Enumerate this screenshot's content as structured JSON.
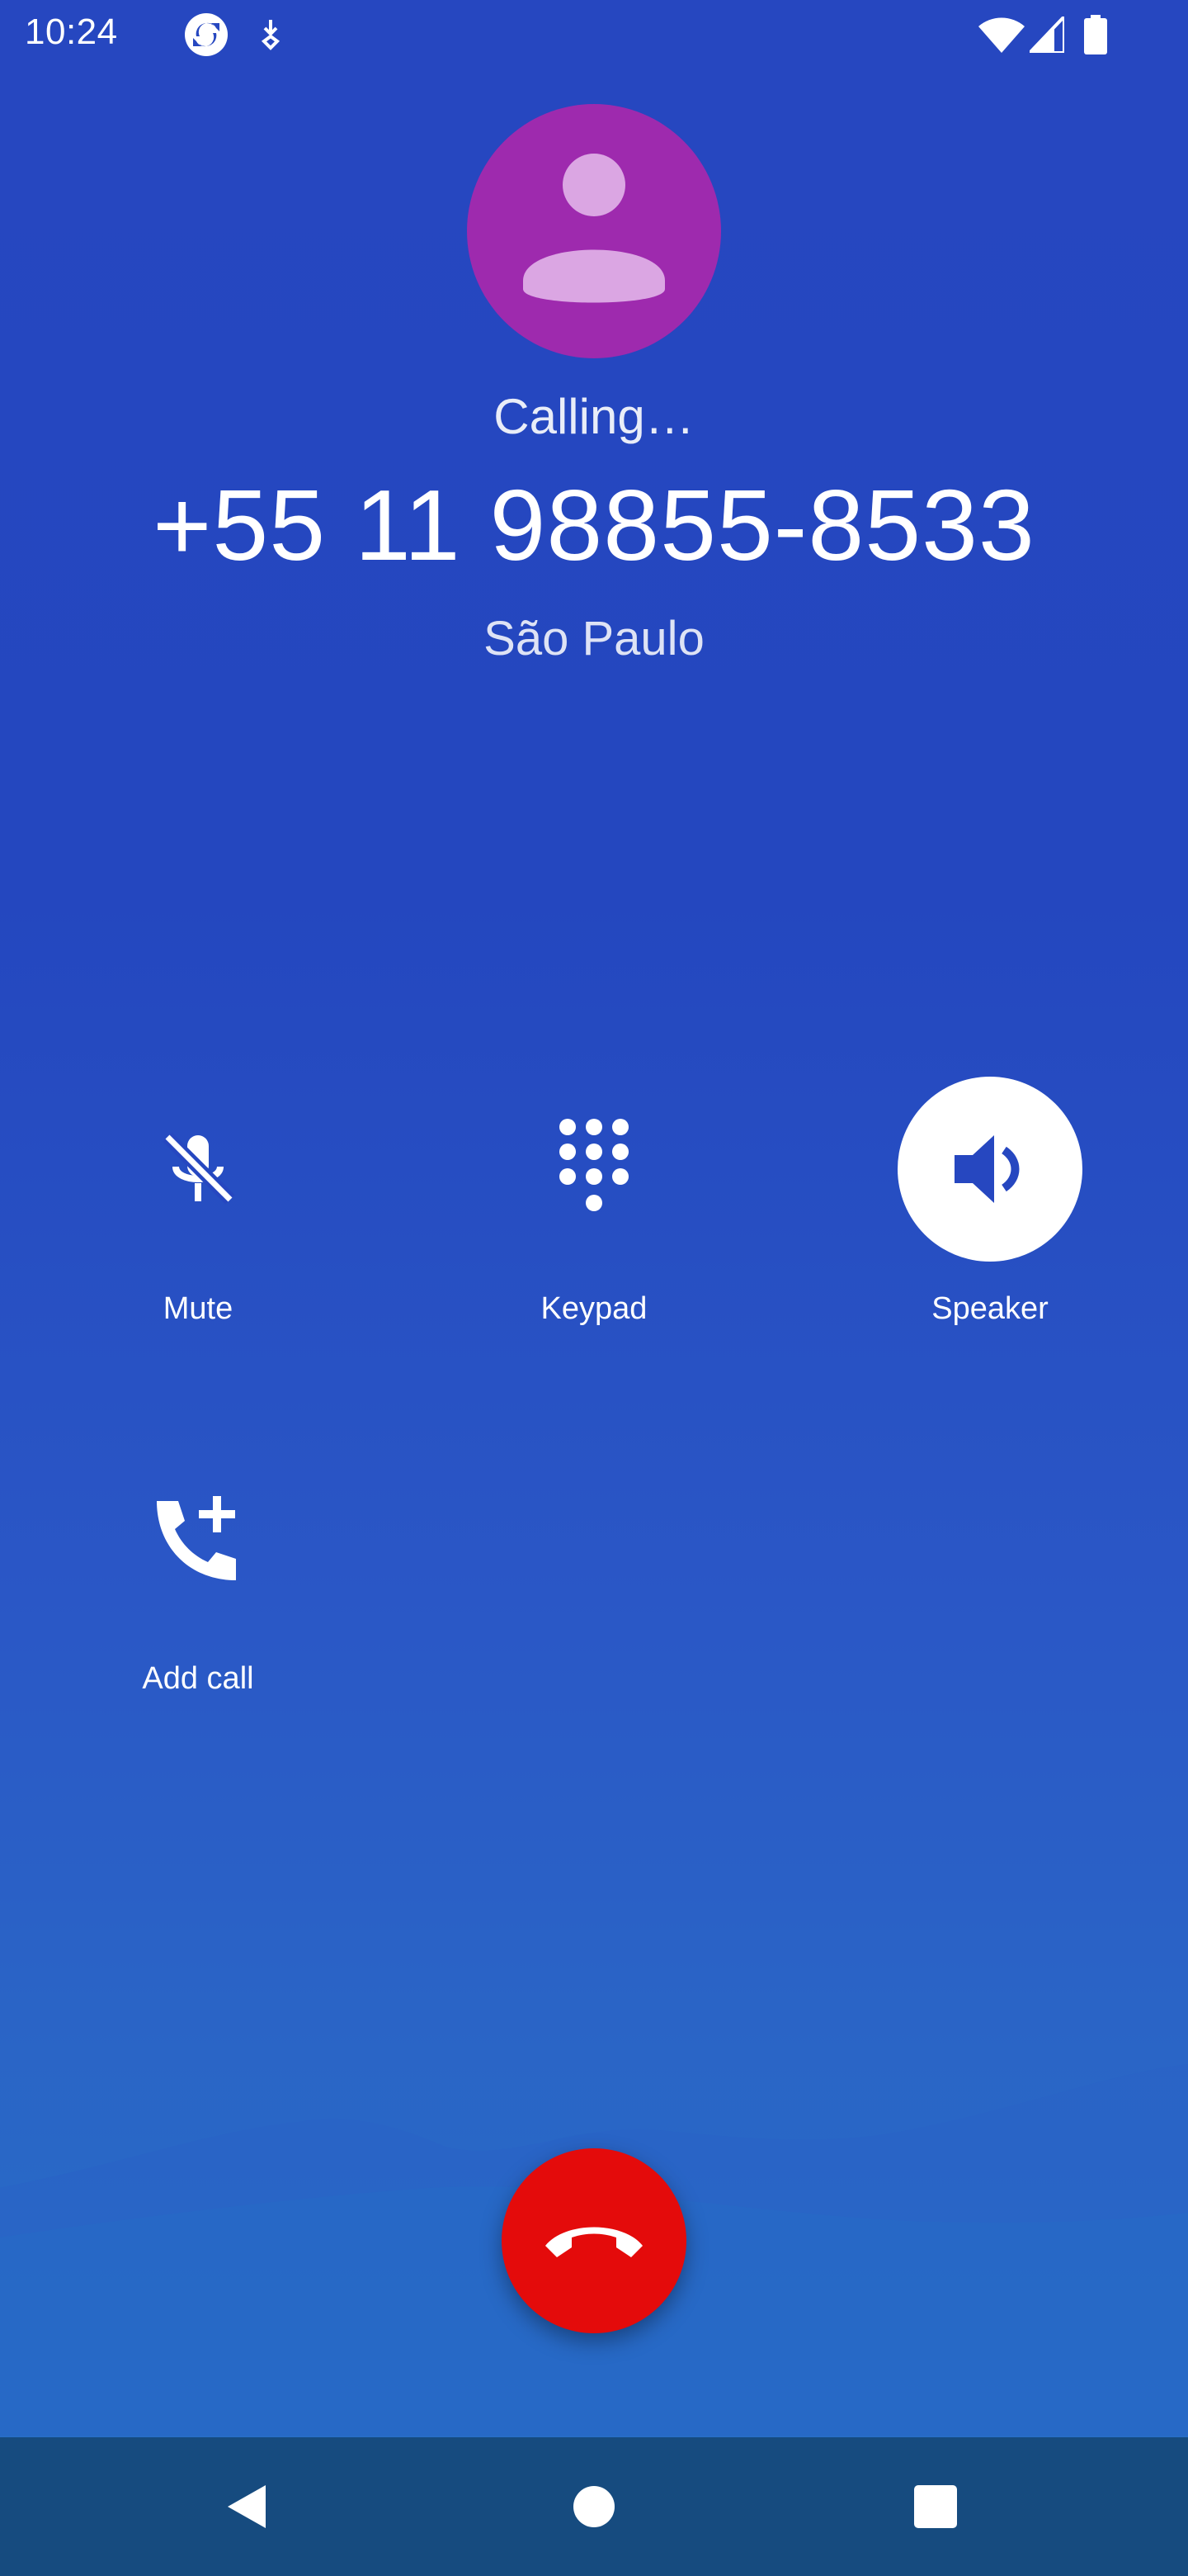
{
  "status_bar": {
    "time": "10:24",
    "icons": [
      "sync-icon",
      "download-icon",
      "wifi-icon",
      "signal-icon",
      "battery-icon"
    ]
  },
  "call": {
    "status": "Calling…",
    "number": "+55 11 98855-8533",
    "location": "São Paulo",
    "avatar_color": "#9e2aae"
  },
  "controls": [
    {
      "label": "Mute",
      "icon": "mic-off-icon",
      "active": false
    },
    {
      "label": "Keypad",
      "icon": "dialpad-icon",
      "active": false
    },
    {
      "label": "Speaker",
      "icon": "speaker-icon",
      "active": true
    },
    {
      "label": "Add call",
      "icon": "add-call-icon",
      "active": false
    }
  ],
  "end_call": {
    "icon": "call-end-icon",
    "color": "#e40b0b"
  },
  "nav_bar": {
    "buttons": [
      "back-icon",
      "home-icon",
      "recents-icon"
    ]
  }
}
